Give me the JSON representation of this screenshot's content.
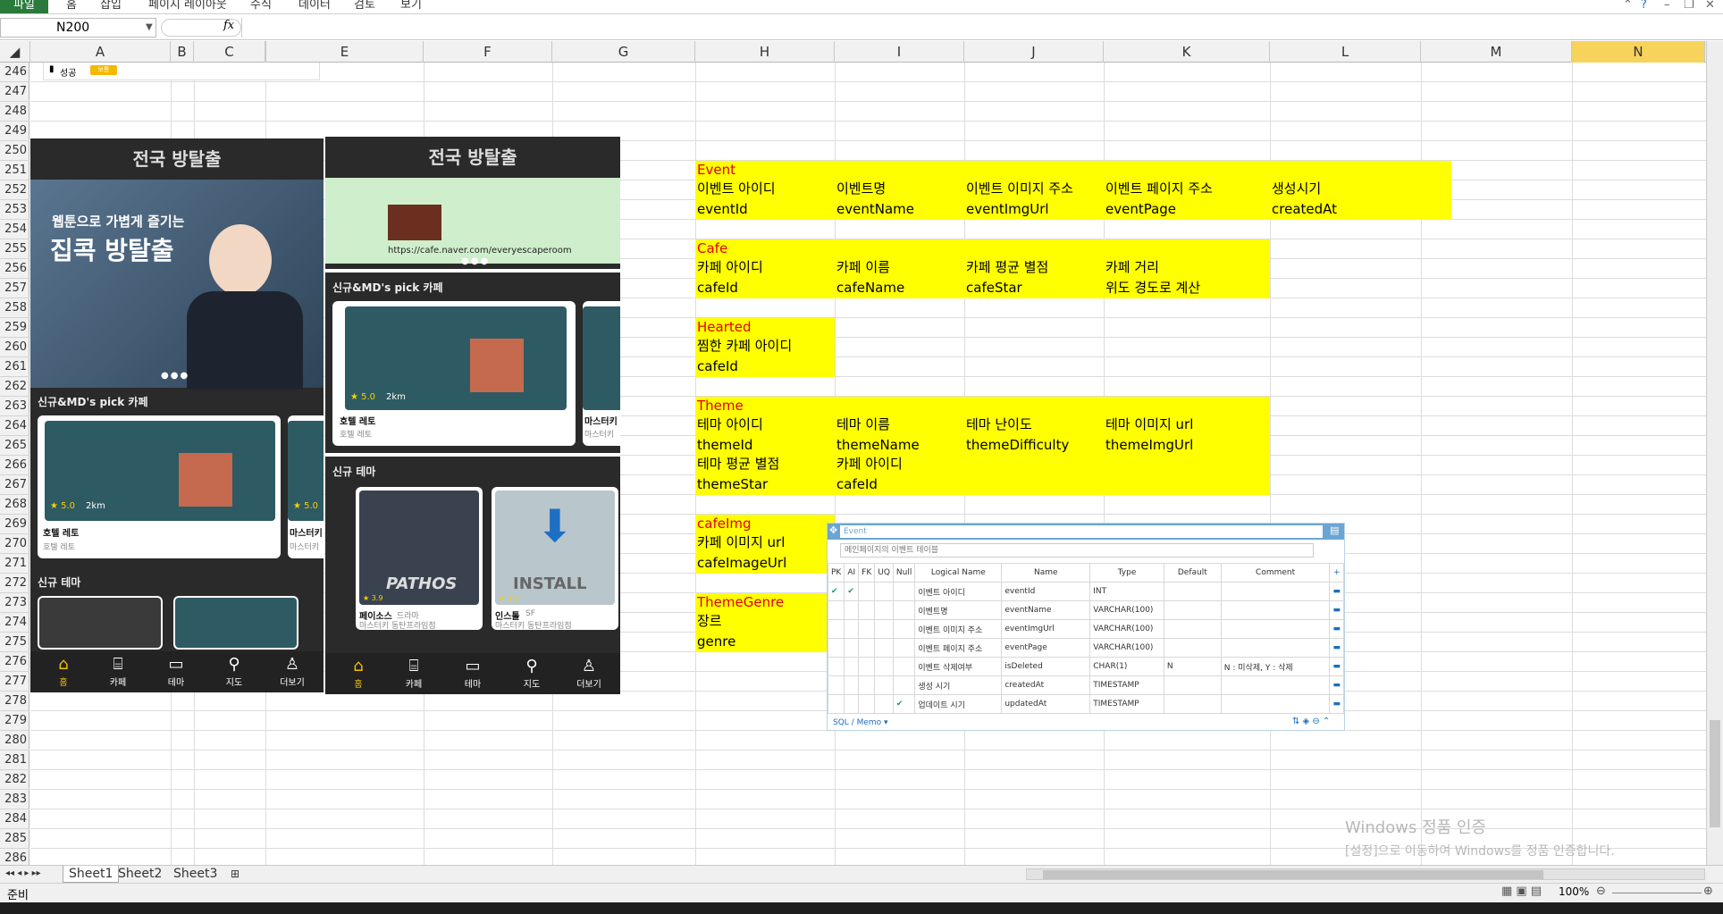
{
  "ribbon": {
    "tabs": [
      "파일",
      "홈",
      "삽입",
      "페이지 레이아웃",
      "수식",
      "데이터",
      "검토",
      "보기"
    ]
  },
  "formula_bar": {
    "name_box": "N200",
    "fx": "fx",
    "formula": ""
  },
  "columns": [
    "A",
    "B",
    "C",
    "",
    "E",
    "F",
    "G",
    "H",
    "I",
    "J",
    "K",
    "L",
    "M",
    "N"
  ],
  "rows": [
    "246",
    "247",
    "248",
    "249",
    "250",
    "251",
    "252",
    "253",
    "254",
    "255",
    "256",
    "257",
    "258",
    "259",
    "260",
    "261",
    "262",
    "263",
    "264",
    "265",
    "266",
    "267",
    "268",
    "269",
    "270",
    "271",
    "272",
    "273",
    "274",
    "275",
    "276",
    "277",
    "278",
    "279",
    "280",
    "281",
    "282",
    "283",
    "284",
    "285",
    "286"
  ],
  "top_card": {
    "status": "성공",
    "badge": "보통"
  },
  "tables": {
    "event": {
      "title": "Event",
      "r1": [
        "이벤트 아이디",
        "이벤트명",
        "이벤트 이미지 주소",
        "이벤트 페이지 주소",
        "생성시기"
      ],
      "r2": [
        "eventId",
        "eventName",
        "eventImgUrl",
        "eventPage",
        "createdAt"
      ]
    },
    "cafe": {
      "title": "Cafe",
      "r1": [
        "카페 아이디",
        "카페 이름",
        "카페 평균 별점",
        "카페 거리"
      ],
      "r2": [
        "cafeId",
        "cafeName",
        "cafeStar",
        "위도 경도로 계산"
      ]
    },
    "hearted": {
      "title": "Hearted",
      "r1": [
        "찜한 카페 아이디"
      ],
      "r2": [
        "cafeId"
      ]
    },
    "theme": {
      "title": "Theme",
      "r1": [
        "테마 아이디",
        "테마 이름",
        "테마 난이도",
        "테마 이미지 url"
      ],
      "r2": [
        "themeId",
        "themeName",
        "themeDifficulty",
        "themeImgUrl"
      ],
      "r3": [
        "테마 평균 별점",
        "카페 아이디"
      ],
      "r4": [
        "themeStar",
        "cafeId"
      ]
    },
    "cafeimg": {
      "title": "cafeImg",
      "r1": [
        "카페 이미지 url"
      ],
      "r2": [
        "cafeImageUrl"
      ]
    },
    "themegenre": {
      "title": "ThemeGenre",
      "r1": [
        "장르"
      ],
      "r2": [
        "genre"
      ]
    }
  },
  "phone1": {
    "title": "전국 방탈출",
    "banner_line1": "웹툰으로 가볍게 즐기는",
    "banner_line2": "집콕 방탈출",
    "section1": "신규&MD's pick 카페",
    "card1": {
      "name": "호텔 레토",
      "sub": "호텔 레토",
      "rating": "★ 5.0",
      "dist": "2km"
    },
    "card2": {
      "name": "마스터키",
      "sub": "마스터키",
      "rating": "★ 5.0"
    },
    "section2": "신규 테마",
    "nav": [
      "홈",
      "카페",
      "테마",
      "지도",
      "더보기"
    ]
  },
  "phone2": {
    "title": "전국 방탈출",
    "banner_url": "https://cafe.naver.com/everyescaperoom",
    "section1": "신규&MD's pick 카페",
    "card1": {
      "name": "호텔 레토",
      "sub": "호텔 레토",
      "rating": "★ 5.0",
      "dist": "2km"
    },
    "card2": {
      "name": "마스터키",
      "sub": "마스터키"
    },
    "section2": "신규 테마",
    "theme1": {
      "name": "페이소스",
      "genre": "드라마",
      "sub": "마스터키 동탄프라임점",
      "rating": "★ 3.9",
      "label": "PATHOS"
    },
    "theme2": {
      "name": "인스톨",
      "genre": "SF",
      "sub": "마스터키 동탄프라임점",
      "rating": "★ 3.9",
      "label": "INSTALL"
    },
    "nav": [
      "홈",
      "카페",
      "테마",
      "지도",
      "더보기"
    ]
  },
  "erd": {
    "table_name": "Event",
    "description": "메인페이지의 이벤트 테이블",
    "headers": [
      "PK",
      "AI",
      "FK",
      "UQ",
      "Null",
      "Logical Name",
      "Name",
      "Type",
      "Default",
      "Comment"
    ],
    "rows": [
      {
        "pk": "✔",
        "ai": "✔",
        "null": "",
        "logical": "이벤트 아이디",
        "name": "eventId",
        "type": "INT",
        "default": "",
        "comment": ""
      },
      {
        "pk": "",
        "ai": "",
        "null": "",
        "logical": "이벤트명",
        "name": "eventName",
        "type": "VARCHAR(100)",
        "default": "",
        "comment": ""
      },
      {
        "pk": "",
        "ai": "",
        "null": "",
        "logical": "이벤트 이미지 주소",
        "name": "eventImgUrl",
        "type": "VARCHAR(100)",
        "default": "",
        "comment": ""
      },
      {
        "pk": "",
        "ai": "",
        "null": "",
        "logical": "이벤트 페이지 주소",
        "name": "eventPage",
        "type": "VARCHAR(100)",
        "default": "",
        "comment": ""
      },
      {
        "pk": "",
        "ai": "",
        "null": "",
        "logical": "이벤트 삭제여부",
        "name": "isDeleted",
        "type": "CHAR(1)",
        "default": "N",
        "comment": "N : 미삭제, Y : 삭제"
      },
      {
        "pk": "",
        "ai": "",
        "null": "",
        "logical": "생성 시기",
        "name": "createdAt",
        "type": "TIMESTAMP",
        "default": "",
        "comment": ""
      },
      {
        "pk": "",
        "ai": "",
        "null": "✔",
        "logical": "업데이트 시기",
        "name": "updatedAt",
        "type": "TIMESTAMP",
        "default": "",
        "comment": ""
      }
    ],
    "footer": "SQL / Memo"
  },
  "sheets": [
    "Sheet1",
    "Sheet2",
    "Sheet3"
  ],
  "status": {
    "ready": "준비",
    "zoom": "100%"
  },
  "watermark": {
    "line1": "Windows 정품 인증",
    "line2": "[설정]으로 이동하여 Windows를 정품 인증합니다."
  }
}
